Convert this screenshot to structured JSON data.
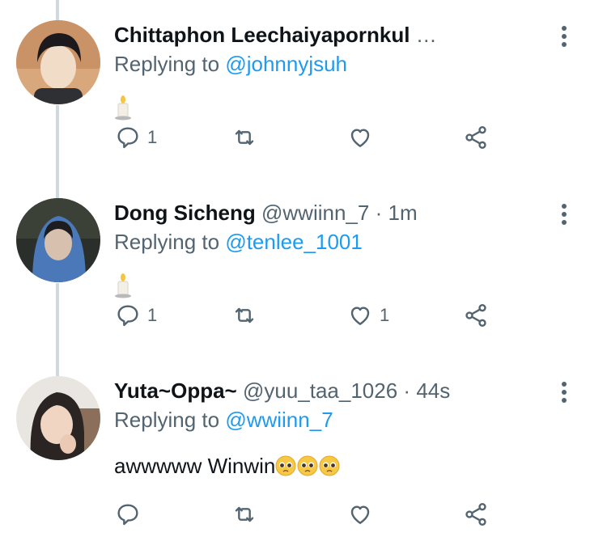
{
  "tweets": [
    {
      "name": "Chittaphon Leechaiyapornkul",
      "handle": "",
      "dot": "",
      "time": "",
      "overflow": "…",
      "replying_label": "Replying to",
      "replying_to": "@johnnyjsuh",
      "text": "",
      "emoji": "candle",
      "reply_count": "1",
      "retweet_count": "",
      "like_count": "",
      "avatar_icon": "avatar-photo"
    },
    {
      "name": "Dong Sicheng",
      "handle": "@wwiinn_7",
      "dot": "·",
      "time": "1m",
      "overflow": "",
      "replying_label": "Replying to",
      "replying_to": "@tenlee_1001",
      "text": "",
      "emoji": "candle",
      "reply_count": "1",
      "retweet_count": "",
      "like_count": "1",
      "avatar_icon": "avatar-photo"
    },
    {
      "name": "Yuta~Oppa~",
      "handle": "@yuu_taa_1026",
      "dot": "·",
      "time": "44s",
      "overflow": "",
      "replying_label": "Replying to",
      "replying_to": "@wwiinn_7",
      "text": "awwwww Winwin",
      "emoji": "pleading-face x3",
      "reply_count": "",
      "retweet_count": "",
      "like_count": "",
      "avatar_icon": "avatar-photo"
    }
  ],
  "icons": {
    "more": "more-vertical-icon",
    "reply": "reply-icon",
    "retweet": "retweet-icon",
    "like": "like-icon",
    "share": "share-icon"
  },
  "colors": {
    "text": "#0f1419",
    "secondary": "#536471",
    "link": "#1d9bf0",
    "thread_line": "#cfd9de"
  }
}
